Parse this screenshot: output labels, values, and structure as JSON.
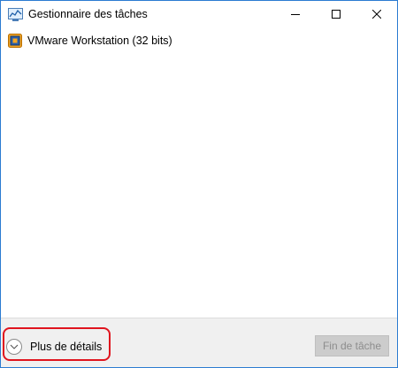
{
  "window": {
    "title": "Gestionnaire des tâches",
    "controls": {
      "minimize": "minimize-icon",
      "maximize": "maximize-icon",
      "close": "close-icon"
    }
  },
  "apps": [
    {
      "label": "VMware Workstation (32 bits)",
      "icon": "vmware-icon"
    }
  ],
  "footer": {
    "details_label": "Plus de détails",
    "details_icon": "chevron-down-icon",
    "end_task_label": "Fin de tâche",
    "end_task_enabled": false,
    "highlight_color": "#e0141e"
  },
  "colors": {
    "border": "#2b7bd1",
    "footer_bg": "#f0f0f0",
    "disabled_button": "#cccccc"
  }
}
